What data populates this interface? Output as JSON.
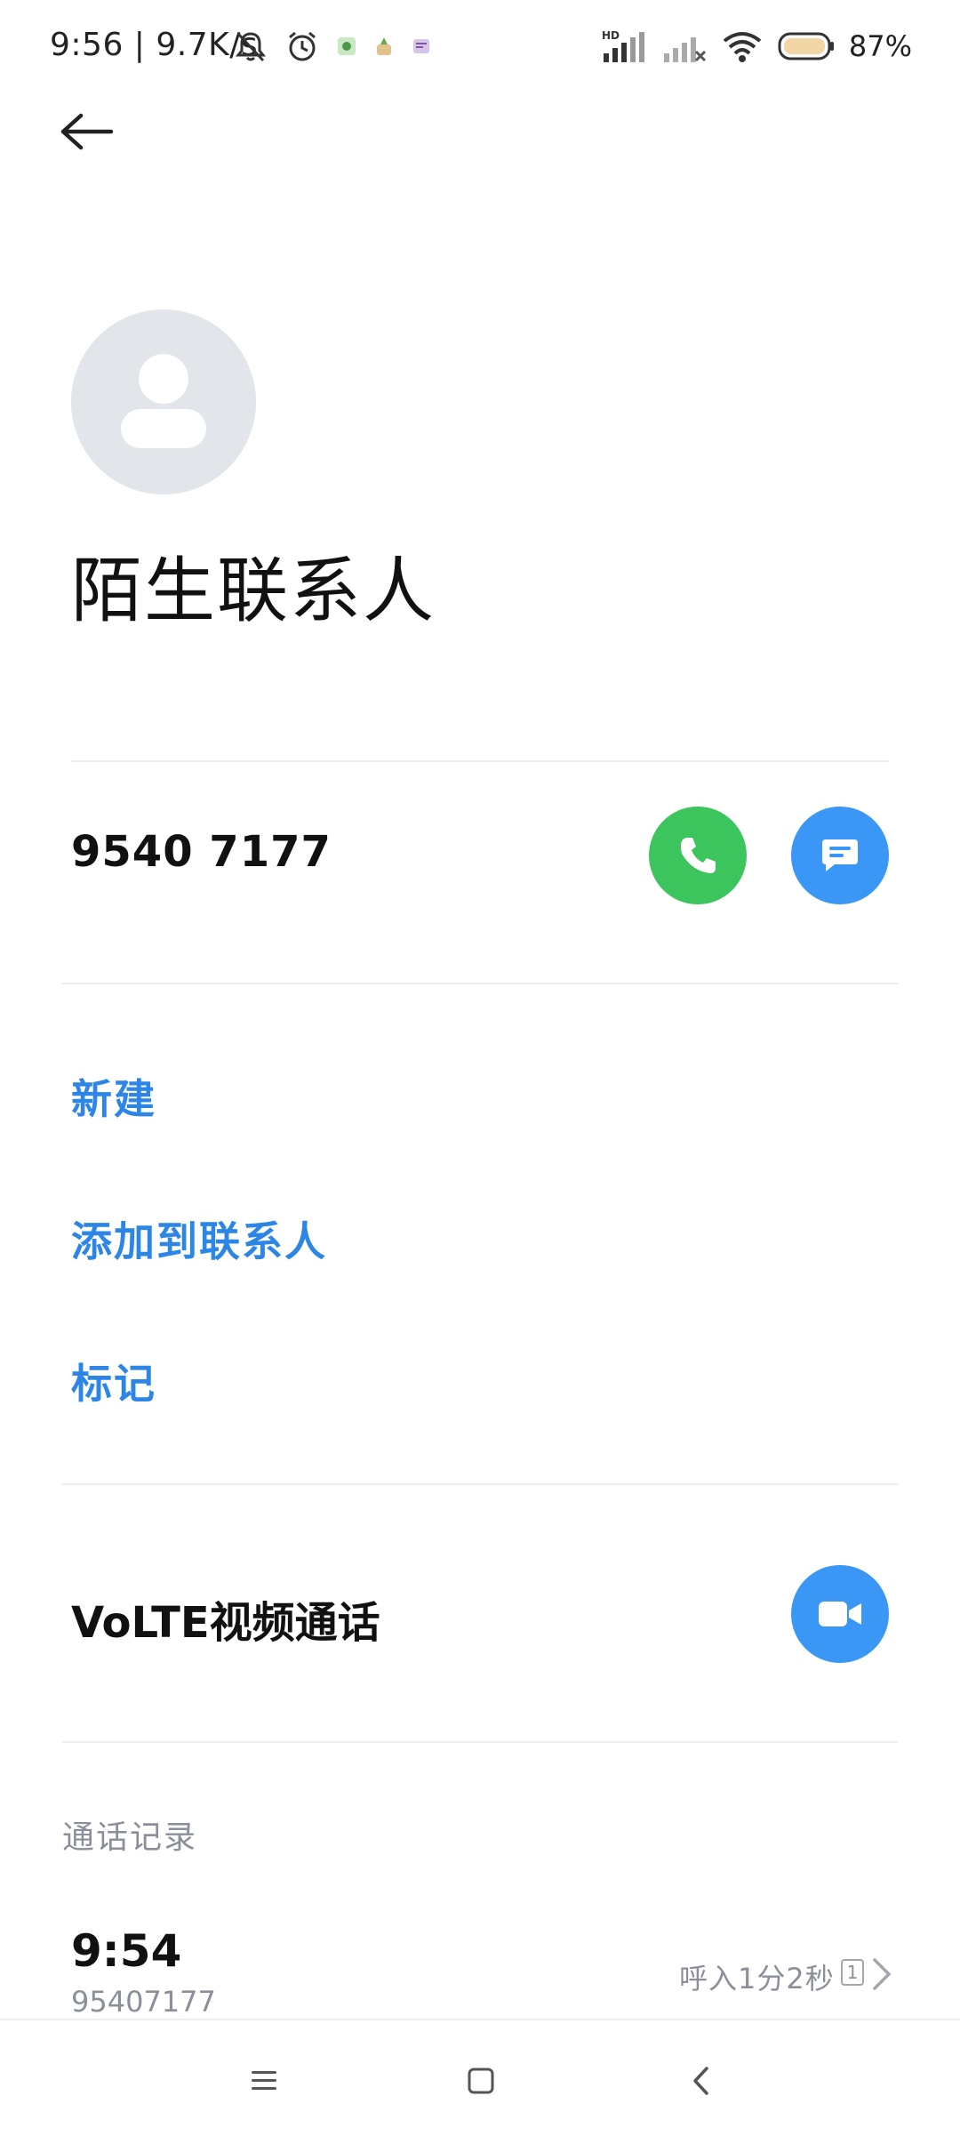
{
  "status_bar": {
    "time_speed": "9:56 | 9.7K/s",
    "battery": "87%",
    "network_label": "HD"
  },
  "header": {
    "back_icon": "arrow-left-icon"
  },
  "contact": {
    "name": "陌生联系人",
    "avatar_icon": "person-icon",
    "phone": "9540 7177"
  },
  "actions": [
    {
      "label": "新建"
    },
    {
      "label": "添加到联系人"
    },
    {
      "label": "标记"
    }
  ],
  "volte": {
    "label": "VoLTE视频通话"
  },
  "call_log": {
    "title": "通话记录",
    "entries": [
      {
        "time": "9:54",
        "number": "95407177",
        "detail": "呼入1分2秒",
        "sim": "1"
      }
    ]
  },
  "colors": {
    "call_green": "#3dc55d",
    "action_blue": "#3a97f5",
    "link_blue": "#2d86e6",
    "avatar_bg": "#e2e5ea"
  }
}
